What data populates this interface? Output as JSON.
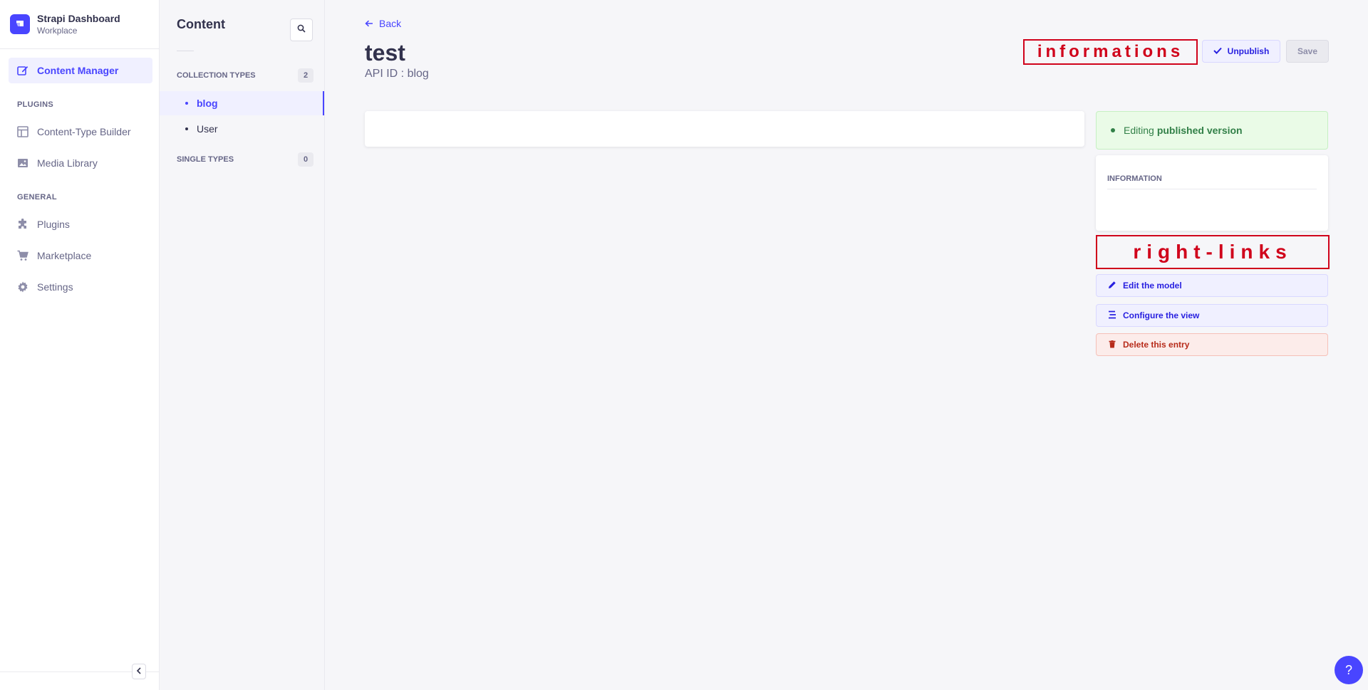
{
  "brand": {
    "title": "Strapi Dashboard",
    "subtitle": "Workplace"
  },
  "mainnav": {
    "content_manager": "Content Manager",
    "plugins_section": "PLUGINS",
    "content_type_builder": "Content-Type Builder",
    "media_library": "Media Library",
    "general_section": "GENERAL",
    "plugins": "Plugins",
    "marketplace": "Marketplace",
    "settings": "Settings"
  },
  "subnav": {
    "title": "Content",
    "collection_types": {
      "label": "COLLECTION TYPES",
      "count": "2"
    },
    "items": [
      "blog",
      "User"
    ],
    "single_types": {
      "label": "SINGLE TYPES",
      "count": "0"
    }
  },
  "header": {
    "back": "Back",
    "title": "test",
    "api_id": "API ID : blog",
    "unpublish": "Unpublish",
    "save": "Save"
  },
  "annotations": {
    "informations": "informations",
    "right_links": "right-links"
  },
  "status": {
    "prefix": "Editing",
    "version": "published version"
  },
  "information": {
    "label": "INFORMATION"
  },
  "links": {
    "edit_model": "Edit the model",
    "configure_view": "Configure the view",
    "delete_entry": "Delete this entry"
  },
  "help": "?",
  "colors": {
    "primary": "#4945ff",
    "success": "#328048",
    "danger": "#b72b1a",
    "annotation": "#d0021b"
  }
}
